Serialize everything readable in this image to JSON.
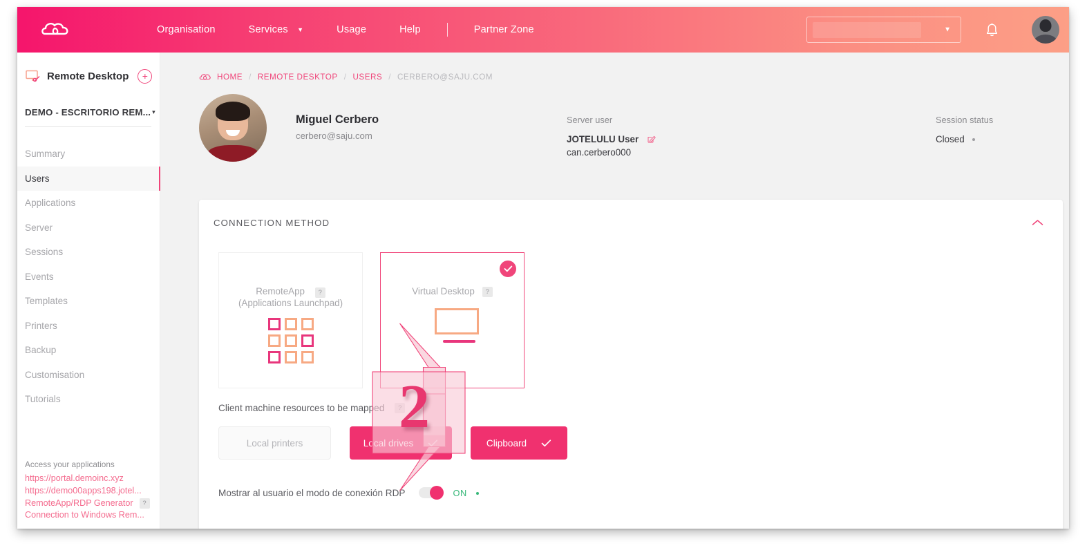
{
  "topnav": {
    "logo_name": "jotelulu-cloud-logo",
    "links": [
      {
        "label": "Organisation",
        "has_caret": false
      },
      {
        "label": "Services",
        "has_caret": true
      },
      {
        "label": "Usage",
        "has_caret": false
      },
      {
        "label": "Help",
        "has_caret": false
      },
      {
        "label": "Partner Zone",
        "has_caret": false
      }
    ],
    "org_select_value": "",
    "bell_icon": "bell-icon",
    "avatar_icon": "user-avatar"
  },
  "sidebar": {
    "service_title": "Remote Desktop",
    "add_label": "+",
    "project": "DEMO - ESCRITORIO REM...",
    "project_caret": "▾",
    "items": [
      {
        "label": "Summary",
        "active": false
      },
      {
        "label": "Users",
        "active": true
      },
      {
        "label": "Applications",
        "active": false
      },
      {
        "label": "Server",
        "active": false
      },
      {
        "label": "Sessions",
        "active": false
      },
      {
        "label": "Events",
        "active": false
      },
      {
        "label": "Templates",
        "active": false
      },
      {
        "label": "Printers",
        "active": false
      },
      {
        "label": "Backup",
        "active": false
      },
      {
        "label": "Customisation",
        "active": false
      },
      {
        "label": "Tutorials",
        "active": false
      }
    ],
    "links_title": "Access your applications",
    "links": [
      {
        "label": "https://portal.demoinc.xyz",
        "help": false
      },
      {
        "label": "https://demo00apps198.jotel...",
        "help": false
      },
      {
        "label": "RemoteApp/RDP Generator",
        "help": true
      },
      {
        "label": "Connection to Windows Rem...",
        "help": false
      }
    ],
    "help_chip": "?"
  },
  "breadcrumb": {
    "home_icon": "cloud-home-icon",
    "items": [
      "HOME",
      "REMOTE DESKTOP",
      "USERS",
      "CERBERO@SAJU.COM"
    ],
    "separator": "/"
  },
  "user_header": {
    "name": "Miguel Cerbero",
    "email": "cerbero@saju.com",
    "server_user_label": "Server user",
    "server_user_value_1": "JOTELULU User",
    "server_user_value_2": "can.cerbero000",
    "edit_icon": "edit-pencil-icon",
    "session_status_label": "Session status",
    "session_status_value": "Closed"
  },
  "panel": {
    "title": "CONNECTION METHOD",
    "collapse_icon": "chevron-up-icon",
    "methods": [
      {
        "label_line1": "RemoteApp",
        "label_line2": "(Applications Launchpad)",
        "selected": false,
        "icon": "apps-grid-icon",
        "help": "?"
      },
      {
        "label_line1": "Virtual Desktop",
        "label_line2": "",
        "selected": true,
        "icon": "monitor-icon",
        "help": "?"
      }
    ],
    "mapped_label": "Client machine resources to be mapped",
    "mapped_help": "?",
    "chips": [
      {
        "label": "Local printers",
        "selected": false
      },
      {
        "label": "Local drives",
        "selected": true
      },
      {
        "label": "Clipboard",
        "selected": true
      }
    ],
    "toggle_label": "Mostrar al usuario el modo de conexión RDP",
    "toggle_state": "ON",
    "toggle_on": true
  },
  "annotation": {
    "step_number": "2",
    "shape": "double-headed-vertical-arrow"
  },
  "colors": {
    "brand_pink": "#f0457a",
    "hot_pink": "#f0316f",
    "salmon": "#f7a983",
    "green": "#38b87a",
    "grey_text": "#8b8b8f"
  }
}
